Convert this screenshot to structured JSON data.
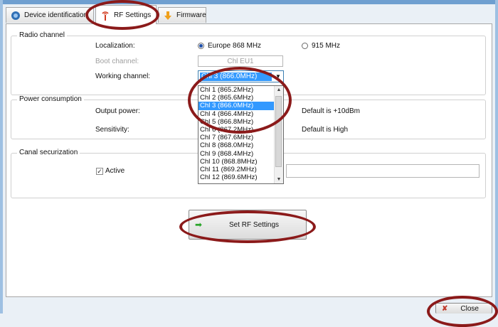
{
  "tabs": [
    {
      "label": "Device identification",
      "icon": "device-id-icon"
    },
    {
      "label": "RF Settings",
      "icon": "antenna-icon"
    },
    {
      "label": "Firmware",
      "icon": "firmware-warning-icon"
    }
  ],
  "radio_channel": {
    "title": "Radio channel",
    "localization_label": "Localization:",
    "options": [
      "Europe 868 MHz",
      "915 MHz"
    ],
    "selected": "Europe 868 MHz",
    "boot_channel_label": "Boot channel:",
    "boot_channel_value": "Chl EU1",
    "working_channel_label": "Working channel:",
    "working_channel_value": "Chl  3   (866.0MHz)",
    "channel_list": [
      "Chl  1   (865.2MHz)",
      "Chl  2   (865.6MHz)",
      "Chl  3   (866.0MHz)",
      "Chl  4   (866.4MHz)",
      "Chl  5   (866.8MHz)",
      "Chl  6   (867.2MHz)",
      "Chl  7   (867.6MHz)",
      "Chl  8   (868.0MHz)",
      "Chl  9   (868.4MHz)",
      "Chl  10   (868.8MHz)",
      "Chl  11   (869.2MHz)",
      "Chl  12   (869.6MHz)"
    ],
    "selected_index": 2
  },
  "power_consumption": {
    "title": "Power consumption",
    "output_power_label": "Output power:",
    "output_power_default": "Default is +10dBm",
    "sensitivity_label": "Sensitivity:",
    "sensitivity_default": "Default is High"
  },
  "canal_securization": {
    "title": "Canal securization",
    "active_label": "Active",
    "active_checked": true
  },
  "set_button": {
    "label": "Set RF Settings",
    "icon": "green-arrow-icon"
  },
  "close_button": {
    "label": "Close",
    "icon": "red-x-icon"
  },
  "colors": {
    "annotation_ring": "#8b1a1a",
    "selection": "#3399ff"
  }
}
